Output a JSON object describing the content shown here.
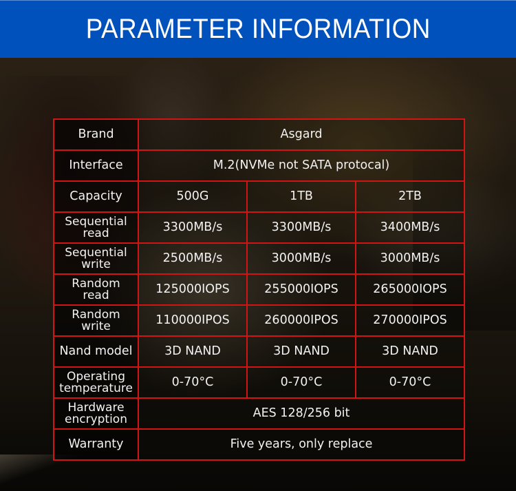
{
  "header": {
    "title": "PARAMETER INFORMATION",
    "background_color": "#0151bd",
    "text_color": "#ffffff"
  },
  "table": {
    "border_color": "#d11414",
    "rows": [
      {
        "label": "Brand",
        "span": true,
        "value": "Asgard"
      },
      {
        "label": "Interface",
        "span": true,
        "value": "M.2(NVMe not SATA protocal)"
      },
      {
        "label": "Capacity",
        "span": false,
        "values": [
          "500G",
          "1TB",
          "2TB"
        ]
      },
      {
        "label_line1": "Sequential",
        "label_line2": "read",
        "span": false,
        "values": [
          "3300MB/s",
          "3300MB/s",
          "3400MB/s"
        ]
      },
      {
        "label_line1": "Sequential",
        "label_line2": "write",
        "span": false,
        "values": [
          "2500MB/s",
          "3000MB/s",
          "3000MB/s"
        ]
      },
      {
        "label_line1": "Random",
        "label_line2": "read",
        "span": false,
        "values": [
          "125000IOPS",
          "255000IOPS",
          "265000IOPS"
        ]
      },
      {
        "label_line1": "Random",
        "label_line2": "write",
        "span": false,
        "values": [
          "110000IPOS",
          "260000IPOS",
          "270000IPOS"
        ]
      },
      {
        "label": "Nand model",
        "span": false,
        "values": [
          "3D NAND",
          "3D NAND",
          "3D NAND"
        ]
      },
      {
        "label_line1": "Operating",
        "label_line2": "temperature",
        "span": false,
        "values": [
          "0-70°C",
          "0-70°C",
          "0-70°C"
        ]
      },
      {
        "label_line1": "Hardware",
        "label_line2": "encryption",
        "span": true,
        "value": "AES 128/256 bit"
      },
      {
        "label": "Warranty",
        "span": true,
        "value": "Five years, only replace"
      }
    ]
  }
}
